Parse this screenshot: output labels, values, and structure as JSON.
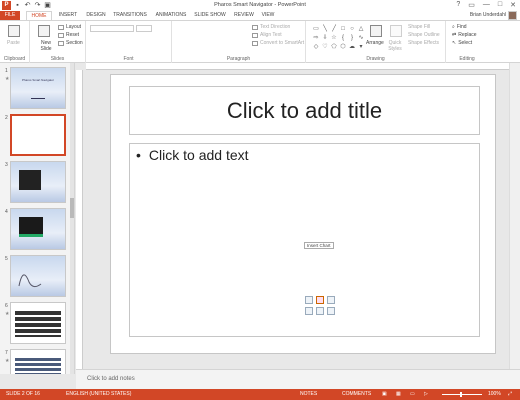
{
  "window": {
    "title": "Pharos Smart Navigator - PowerPoint",
    "user": "Brian Underdahl",
    "controls": [
      "?",
      "▭",
      "—",
      "□",
      "✕"
    ]
  },
  "tabs": [
    "FILE",
    "HOME",
    "INSERT",
    "DESIGN",
    "TRANSITIONS",
    "ANIMATIONS",
    "SLIDE SHOW",
    "REVIEW",
    "VIEW"
  ],
  "ribbon": {
    "clipboard": {
      "label": "Clipboard",
      "paste": "Paste"
    },
    "slides": {
      "label": "Slides",
      "new_slide": "New Slide",
      "layout": "Layout",
      "reset": "Reset",
      "section": "Section"
    },
    "font": {
      "label": "Font"
    },
    "paragraph": {
      "label": "Paragraph",
      "text_direction": "Text Direction",
      "align_text": "Align Text",
      "convert": "Convert to SmartArt"
    },
    "drawing": {
      "label": "Drawing",
      "arrange": "Arrange",
      "quick_styles": "Quick Styles",
      "shape_fill": "Shape Fill",
      "shape_outline": "Shape Outline",
      "shape_effects": "Shape Effects"
    },
    "editing": {
      "label": "Editing",
      "find": "Find",
      "replace": "Replace",
      "select": "Select"
    }
  },
  "thumbnails": [
    {
      "num": "1",
      "star": "★",
      "caption": "Pharos Smart Navigator"
    },
    {
      "num": "2",
      "star": "",
      "caption": ""
    },
    {
      "num": "3",
      "star": "",
      "caption": ""
    },
    {
      "num": "4",
      "star": "",
      "caption": ""
    },
    {
      "num": "5",
      "star": "",
      "caption": ""
    },
    {
      "num": "6",
      "star": "★",
      "caption": ""
    },
    {
      "num": "7",
      "star": "★",
      "caption": ""
    }
  ],
  "slide": {
    "title_placeholder": "Click to add title",
    "body_placeholder": "Click to add text",
    "bullet": "•",
    "tooltip": "Insert Chart"
  },
  "notes": {
    "placeholder": "Click to add notes"
  },
  "status": {
    "slide": "SLIDE 2 OF 16",
    "language": "ENGLISH (UNITED STATES)",
    "notes": "NOTES",
    "comments": "COMMENTS",
    "zoom": "100%"
  },
  "colors": {
    "accent": "#d24726"
  }
}
